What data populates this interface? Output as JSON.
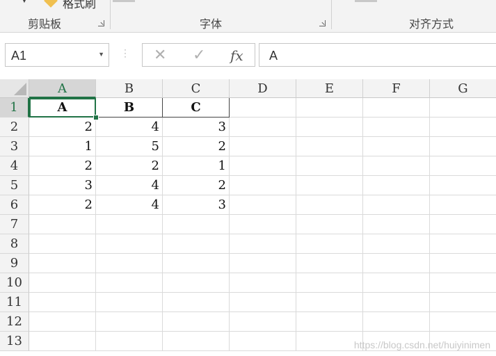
{
  "ribbon": {
    "format_painter_label": "格式刷",
    "groups": [
      {
        "label": "剪贴板"
      },
      {
        "label": "字体"
      },
      {
        "label": "对齐方式"
      }
    ]
  },
  "formula_bar": {
    "name_box": "A1",
    "cancel_icon": "✕",
    "enter_icon": "✓",
    "fx_label": "fx",
    "formula_value": "A"
  },
  "columns": [
    "A",
    "B",
    "C",
    "D",
    "E",
    "F",
    "G"
  ],
  "rows": [
    "1",
    "2",
    "3",
    "4",
    "5",
    "6",
    "7",
    "8",
    "9",
    "10",
    "11",
    "12",
    "13"
  ],
  "selected_cell": "A1",
  "cells": {
    "header": [
      "A",
      "B",
      "C"
    ],
    "data": [
      [
        "2",
        "4",
        "3"
      ],
      [
        "1",
        "5",
        "2"
      ],
      [
        "2",
        "2",
        "1"
      ],
      [
        "3",
        "4",
        "2"
      ],
      [
        "2",
        "4",
        "3"
      ]
    ]
  },
  "watermark": "https://blog.csdn.net/huiyinimen",
  "colors": {
    "accent": "#217346",
    "header_bg": "#f3f3f3",
    "selected_header_bg": "#d6d6d6"
  }
}
